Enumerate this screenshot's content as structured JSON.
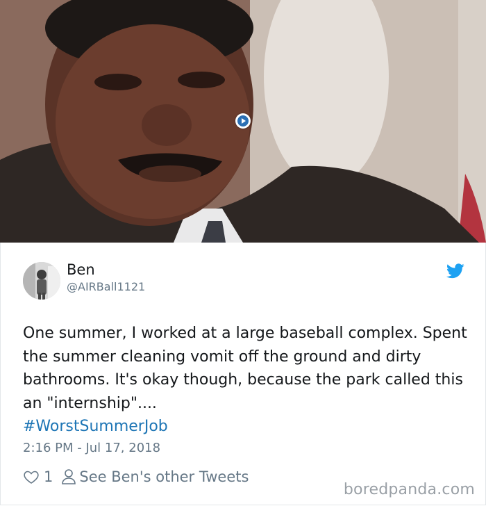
{
  "photo": {
    "subject": "man-portrait-image",
    "play_icon": "play-circle-icon"
  },
  "tweet": {
    "name": "Ben",
    "handle": "@AIRBall1121",
    "text": "One summer, I worked at a large baseball complex. Spent the summer cleaning vomit off the ground and dirty bathrooms. It's okay though, because the park called this an \"internship\"....",
    "hashtag": "#WorstSummerJob",
    "timestamp": "2:16 PM - Jul 17, 2018",
    "likes": "1",
    "see_other": "See Ben's other Tweets",
    "bird_icon": "twitter-bird-icon"
  },
  "watermark": "boredpanda.com",
  "colors": {
    "link": "#1d75b5",
    "twitter_blue": "#1da1f2",
    "muted": "#657786"
  }
}
